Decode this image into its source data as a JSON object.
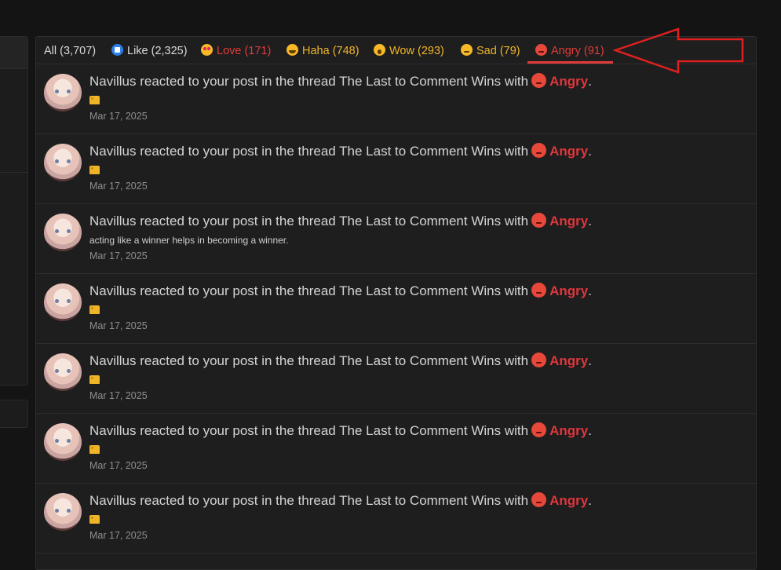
{
  "tabs": {
    "all": "All (3,707)",
    "like": "Like (2,325)",
    "love": "Love (171)",
    "haha": "Haha (748)",
    "wow": "Wow (293)",
    "sad": "Sad (79)",
    "angry": "Angry (91)"
  },
  "colors": {
    "accent_red": "#e23b3b",
    "accent_yellow": "#f0b429",
    "like_blue": "#2d7ee6",
    "annotation_arrow": "#e02020"
  },
  "icons": {
    "like": "like-icon",
    "love": "love-icon",
    "haha": "haha-icon",
    "wow": "wow-icon",
    "sad": "sad-icon",
    "angry": "angry-icon",
    "snippet": "cheese-icon"
  },
  "notifications": [
    {
      "prefix": "Navillus reacted to your post in the thread The Last to Comment Wins with",
      "reaction": "Angry",
      "suffix": ".",
      "snippet": "",
      "has_cheese": true,
      "date": "Mar 17, 2025"
    },
    {
      "prefix": "Navillus reacted to your post in the thread The Last to Comment Wins with",
      "reaction": "Angry",
      "suffix": ".",
      "snippet": "",
      "has_cheese": true,
      "date": "Mar 17, 2025"
    },
    {
      "prefix": "Navillus reacted to your post in the thread The Last to Comment Wins with",
      "reaction": "Angry",
      "suffix": ".",
      "snippet": "acting like a winner helps in becoming a winner.",
      "has_cheese": false,
      "date": "Mar 17, 2025"
    },
    {
      "prefix": "Navillus reacted to your post in the thread The Last to Comment Wins with",
      "reaction": "Angry",
      "suffix": ".",
      "snippet": "",
      "has_cheese": true,
      "date": "Mar 17, 2025"
    },
    {
      "prefix": "Navillus reacted to your post in the thread The Last to Comment Wins with",
      "reaction": "Angry",
      "suffix": ".",
      "snippet": "",
      "has_cheese": true,
      "date": "Mar 17, 2025"
    },
    {
      "prefix": "Navillus reacted to your post in the thread The Last to Comment Wins with",
      "reaction": "Angry",
      "suffix": ".",
      "snippet": "",
      "has_cheese": true,
      "date": "Mar 17, 2025"
    },
    {
      "prefix": "Navillus reacted to your post in the thread The Last to Comment Wins with",
      "reaction": "Angry",
      "suffix": ".",
      "snippet": "",
      "has_cheese": true,
      "date": "Mar 17, 2025"
    }
  ]
}
